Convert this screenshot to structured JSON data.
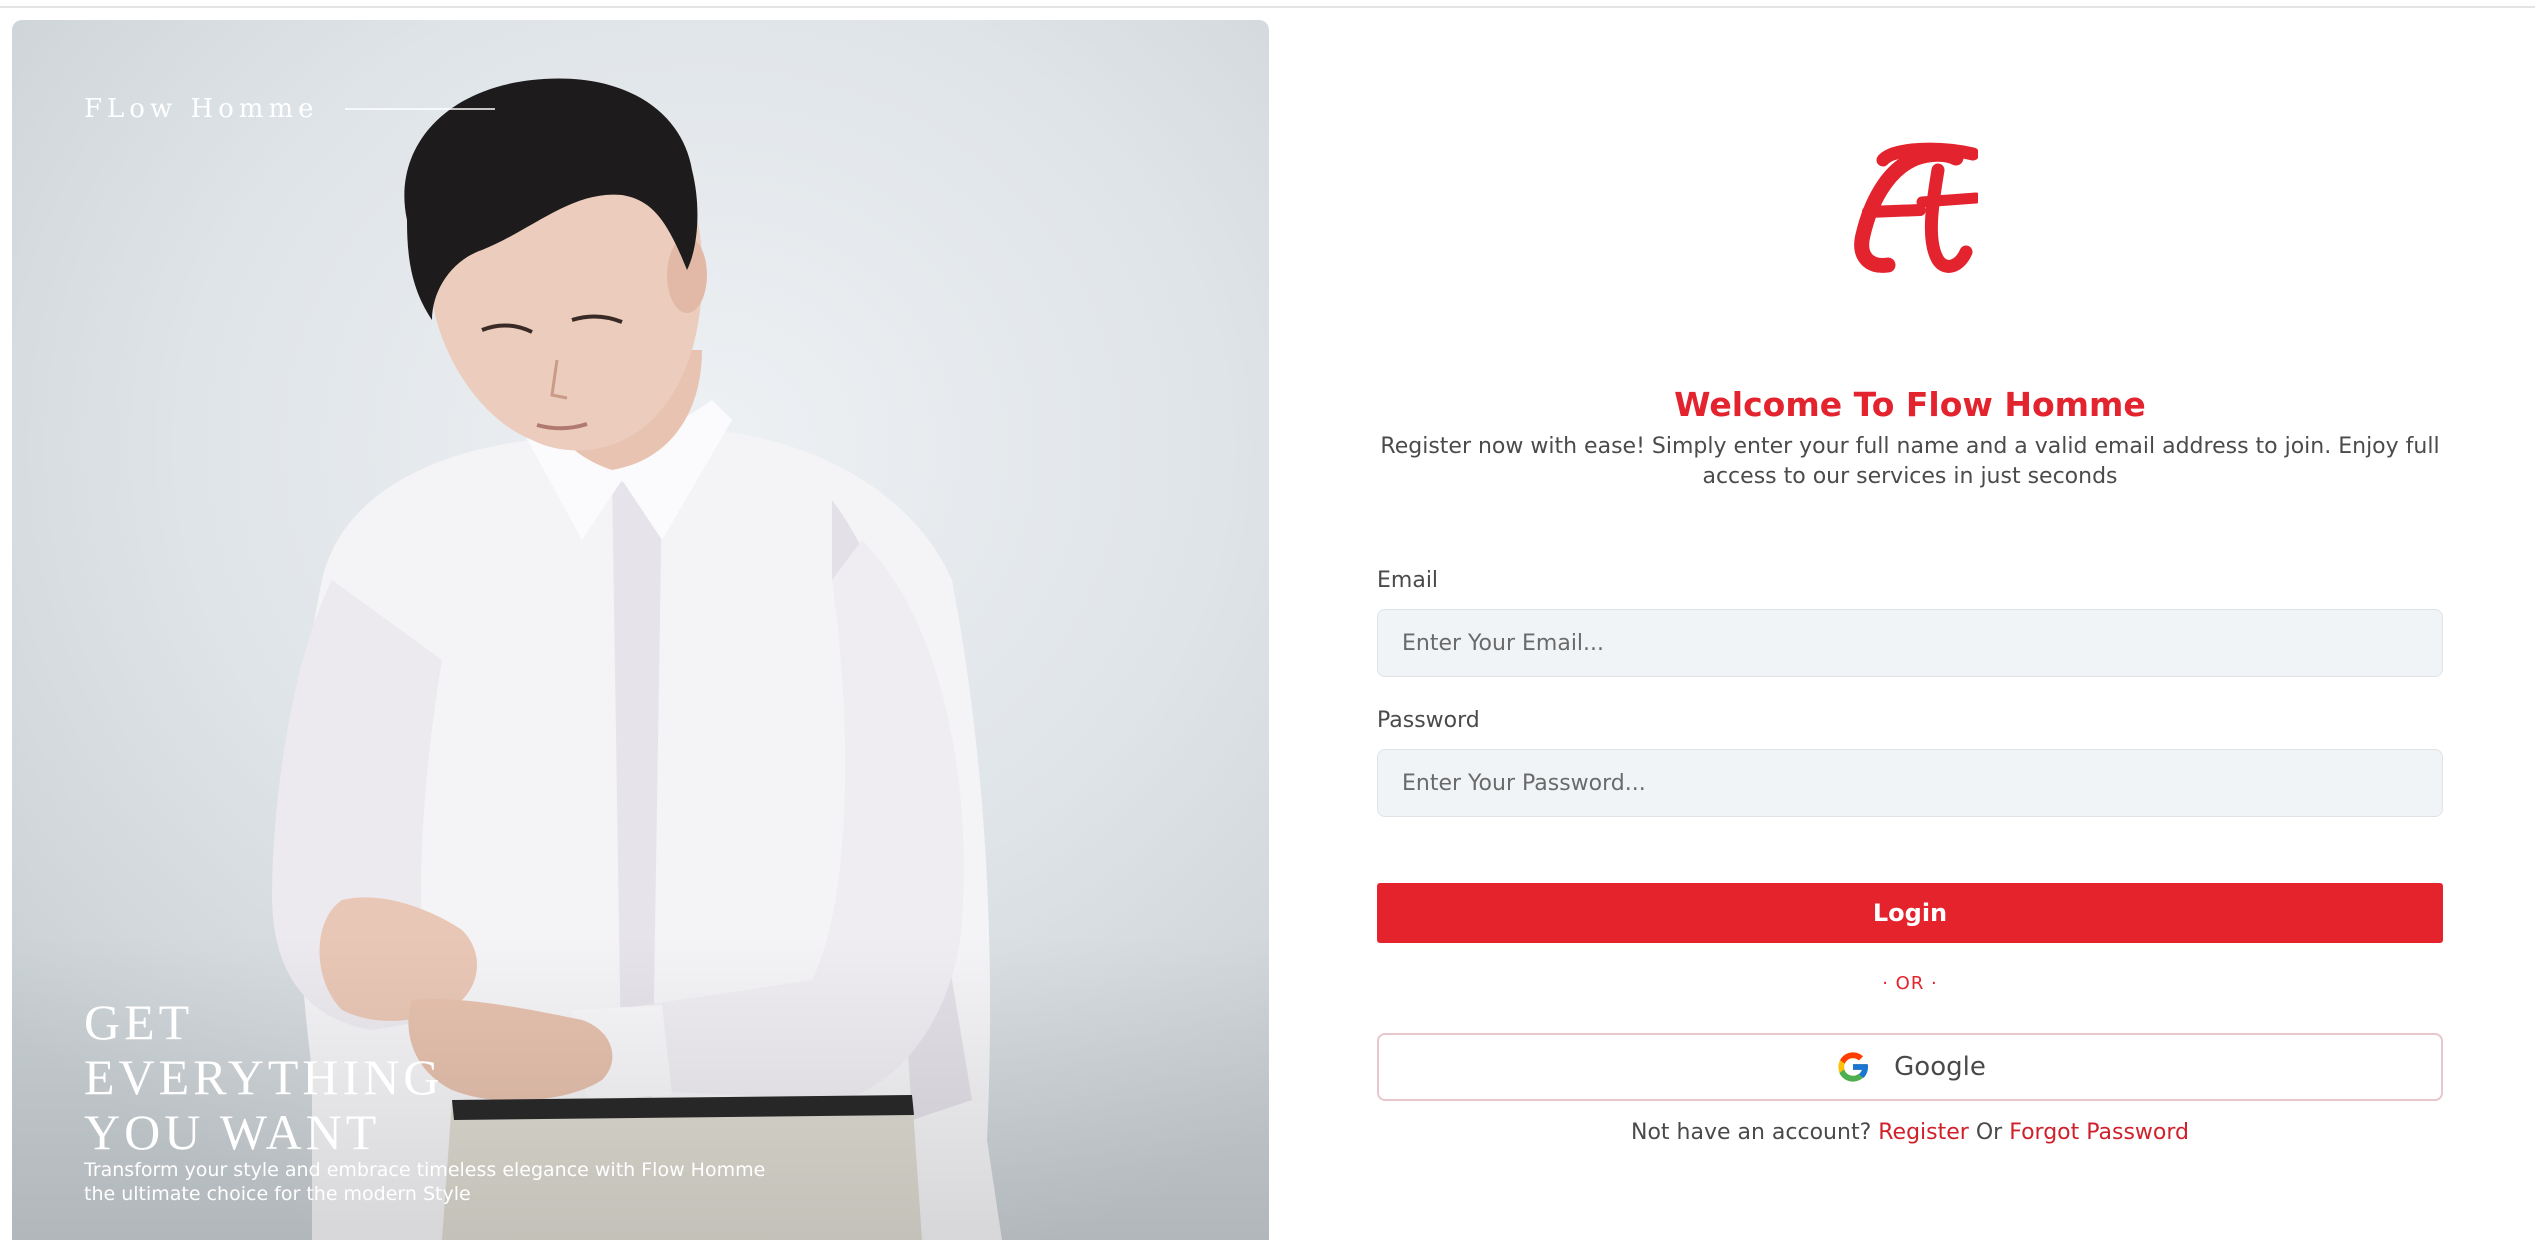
{
  "hero": {
    "brand": "FLow Homme",
    "headline_lines": [
      "GET",
      "EVERYTHING",
      "YOU WANT"
    ],
    "sub_lines": [
      "Transform your style and embrace timeless elegance with Flow Homme",
      "the ultimate choice for the modern Style"
    ]
  },
  "form": {
    "title": "Welcome To Flow Homme",
    "intro": "Register now with ease! Simply enter your full name and a valid email address to join. Enjoy full access to our services in just seconds",
    "email": {
      "label": "Email",
      "placeholder": "Enter Your Email...",
      "value": ""
    },
    "password": {
      "label": "Password",
      "placeholder": "Enter Your Password...",
      "value": ""
    },
    "login_label": "Login",
    "or_text": "· OR ·",
    "google_label": "Google",
    "footer": {
      "prompt": "Not have an account?",
      "register_label": "Register",
      "or_word": "Or",
      "forgot_label": "Forgot Password"
    }
  },
  "icons": {
    "logo": "flow-homme-monogram-icon",
    "google": "google-g-icon"
  },
  "colors": {
    "accent": "#e4232d",
    "input_bg": "#f1f4f7",
    "google_border": "#e8c7cd"
  }
}
